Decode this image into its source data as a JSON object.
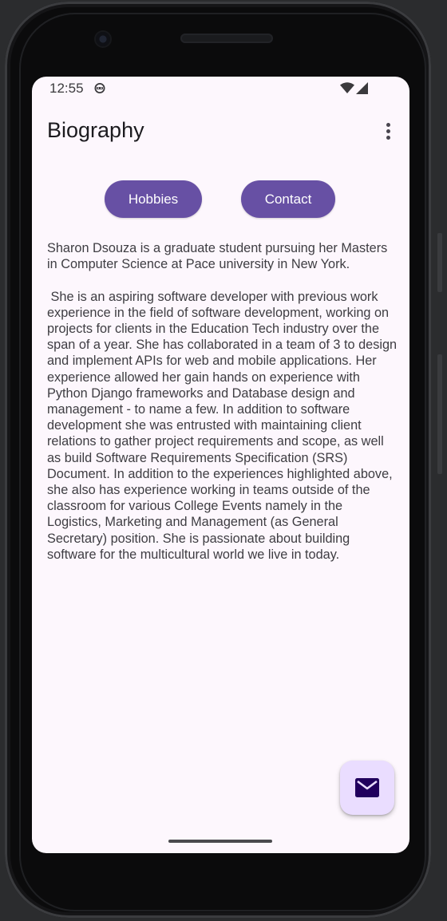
{
  "status_bar": {
    "time": "12:55",
    "icons": [
      "android-robot-icon",
      "wifi-icon",
      "cell-signal-icon"
    ]
  },
  "app_bar": {
    "title": "Biography",
    "overflow_icon": "more-vert-icon"
  },
  "buttons": {
    "hobbies": "Hobbies",
    "contact": "Contact"
  },
  "bio": {
    "paragraph_1": "Sharon Dsouza is a graduate student pursuing her Masters in Computer Science at Pace university in New York.",
    "paragraph_2": " She is an aspiring software developer with previous work experience in the field of software development, working on projects for clients in the Education Tech industry over the span of a year. She has collaborated in a team of 3 to design and implement APIs for web and mobile applications. Her experience allowed her gain hands on experience with Python Django frameworks and Database design and management - to name a few. In addition to software development she was entrusted with maintaining client relations to gather project requirements and scope, as well as build Software Requirements Specification (SRS) Document. In addition to the experiences highlighted above, she also has experience working in teams outside of the classroom for various College Events namely in the Logistics, Marketing and Management (as General Secretary) position. She is passionate about building software for the multicultural world we live in today."
  },
  "fab": {
    "icon": "email-icon"
  },
  "colors": {
    "primary": "#6750a4",
    "background": "#fdf7fd",
    "fab_container": "#eaddff",
    "fab_icon": "#21005d"
  }
}
